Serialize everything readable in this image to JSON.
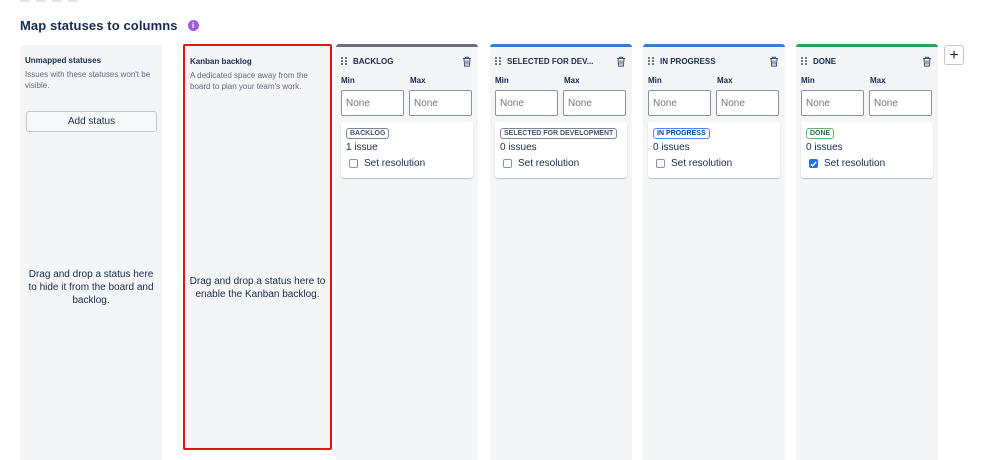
{
  "heading": {
    "title": "Map statuses to columns",
    "info_icon": "info-icon"
  },
  "unmapped": {
    "title": "Unmapped statuses",
    "description": "Issues with these statuses won't be visible.",
    "add_status_label": "Add status",
    "drop_hint": "Drag and drop a status here to hide it from the board and backlog."
  },
  "kanban_backlog": {
    "title": "Kanban backlog",
    "description": "A dedicated space away from the board to plan your team's work.",
    "drop_hint": "Drag and drop a status here to enable the Kanban backlog."
  },
  "min_label": "Min",
  "max_label": "Max",
  "input_placeholder": "None",
  "resolution_label": "Set resolution",
  "columns": [
    {
      "name": "BACKLOG",
      "bar_color": "#6b6e76",
      "status": "BACKLOG",
      "issues": "1 issue",
      "resolution_checked": false
    },
    {
      "name": "SELECTED FOR DEV...",
      "bar_color": "#2f7de1",
      "status": "SELECTED FOR DEVELOPMENT",
      "issues": "0 issues",
      "resolution_checked": false
    },
    {
      "name": "IN PROGRESS",
      "bar_color": "#2f7de1",
      "status": "IN PROGRESS",
      "issues": "0 issues",
      "resolution_checked": false
    },
    {
      "name": "DONE",
      "bar_color": "#22a55a",
      "status": "DONE",
      "issues": "0 issues",
      "resolution_checked": true
    }
  ],
  "add_column_label": "+"
}
